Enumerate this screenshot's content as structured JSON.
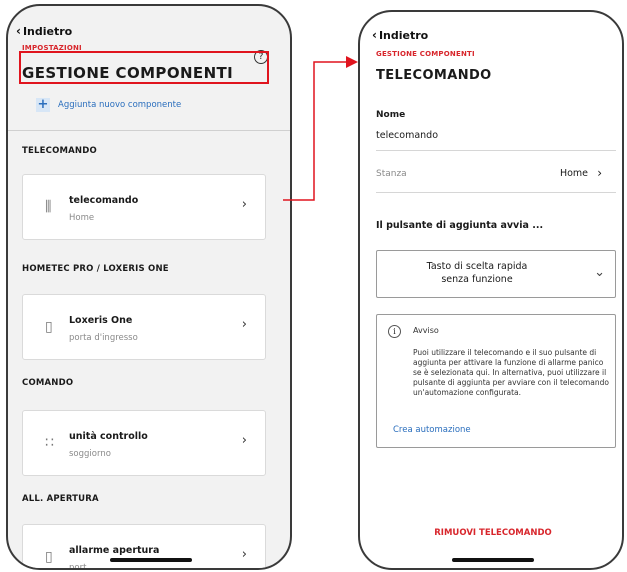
{
  "left_screen": {
    "back_label": "Indietro",
    "settings_label": "IMPOSTAZIONI",
    "title": "GESTIONE COMPONENTI",
    "help_symbol": "?",
    "add_label": "Aggiunta nuovo componente",
    "sections": [
      {
        "header": "TELECOMANDO",
        "item": {
          "name": "telecomando",
          "location": "Home",
          "icon": "remote-icon"
        }
      },
      {
        "header": "HOMETEC PRO / LOXERIS ONE",
        "item": {
          "name": "Loxeris One",
          "location": "porta d'ingresso",
          "icon": "door-lock-icon"
        }
      },
      {
        "header": "COMANDO",
        "item": {
          "name": "unità controllo",
          "location": "soggiorno",
          "icon": "keypad-icon"
        }
      },
      {
        "header": "ALL. APERTURA",
        "item": {
          "name": "allarme apertura",
          "location": "port",
          "icon": "door-sensor-icon"
        }
      }
    ]
  },
  "right_screen": {
    "back_label": "Indietro",
    "section_label": "GESTIONE COMPONENTI",
    "title": "TELECOMANDO",
    "name_label": "Nome",
    "name_value": "telecomando",
    "room_label": "Stanza",
    "room_value": "Home",
    "button_question": "Il pulsante di aggiunta avvia ...",
    "select_line1": "Tasto di scelta rapida",
    "select_line2": "senza funzione",
    "notice_title": "Avviso",
    "notice_body": "Puoi utilizzare il telecomando e il suo pulsante di aggiunta per attivare la funzione di allarme panico se è selezionata qui. In alternativa, puoi utilizzare il pulsante di aggiunta per avviare con il telecomando un'automazione configurata.",
    "notice_link": "Crea automazione",
    "remove_label": "RIMUOVI TELECOMANDO"
  },
  "colors": {
    "accent_red": "#d8262c",
    "highlight_red": "#e0141e",
    "link_blue": "#2a6ebd"
  }
}
